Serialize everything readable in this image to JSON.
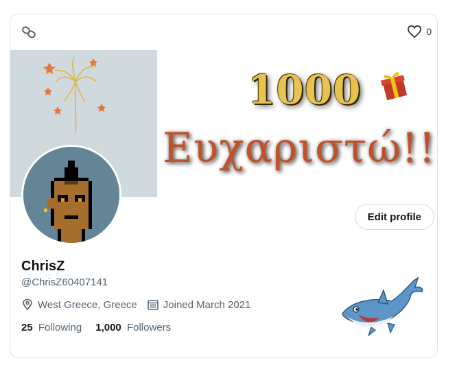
{
  "header": {
    "chain_icon": "chain-link-icon",
    "like_icon": "heart-icon",
    "like_count": "0"
  },
  "banner": {
    "title_line1": "1000",
    "title_line2": "Ευχαριστώ!!!",
    "colors": {
      "gray": "#cfd9de",
      "gold": "#e8c24f",
      "rust": "#c0522a"
    }
  },
  "profile": {
    "name": "ChrisZ",
    "handle": "@ChrisZ60407141",
    "location": "West Greece, Greece",
    "joined": "Joined March 2021",
    "following_count": "25",
    "following_label": "Following",
    "followers_count": "1,000",
    "followers_label": "Followers",
    "edit_label": "Edit profile"
  }
}
